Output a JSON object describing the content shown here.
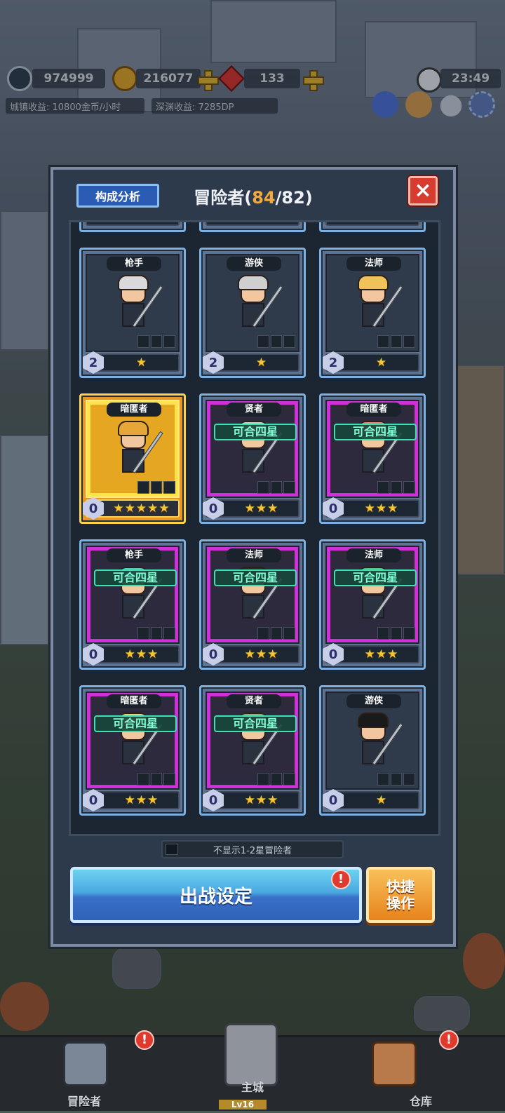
{
  "hud": {
    "currency1": "974999",
    "gold": "216077",
    "gems": "133",
    "time": "23:49",
    "town_income": "城镇收益: 10800金币/小时",
    "abyss_income": "深渊收益: 7285DP"
  },
  "panel": {
    "analysis_label": "构成分析",
    "title_prefix": "冒险者(",
    "count": "84",
    "title_suffix": "/82)",
    "close_symbol": "×",
    "toggle_label": "不显示1-2星冒险者",
    "deploy_label": "出战设定",
    "quick_label_line1": "快捷",
    "quick_label_line2": "操作",
    "alert_symbol": "!"
  },
  "cards": [
    {
      "class": "枪手",
      "level": "2",
      "stars": "★",
      "merge": "",
      "style": "normal",
      "hair": "#d9d9d9"
    },
    {
      "class": "游侠",
      "level": "2",
      "stars": "★",
      "merge": "",
      "style": "normal",
      "hair": "#cfcfcf"
    },
    {
      "class": "法师",
      "level": "2",
      "stars": "★",
      "merge": "",
      "style": "normal",
      "hair": "#f0c35a"
    },
    {
      "class": "暗匿者",
      "level": "0",
      "stars": "★★★★★",
      "merge": "",
      "style": "gold",
      "hair": "#e7a63a"
    },
    {
      "class": "贤者",
      "level": "0",
      "stars": "★★★",
      "merge": "可合四星",
      "style": "purple",
      "hair": "#c9d6cf"
    },
    {
      "class": "暗匿者",
      "level": "0",
      "stars": "★★★",
      "merge": "可合四星",
      "style": "purple",
      "hair": "#e9887a"
    },
    {
      "class": "枪手",
      "level": "0",
      "stars": "★★★",
      "merge": "可合四星",
      "style": "purple",
      "hair": "#5bc6c6"
    },
    {
      "class": "法师",
      "level": "0",
      "stars": "★★★",
      "merge": "可合四星",
      "style": "purple",
      "hair": "#2a2a2a"
    },
    {
      "class": "法师",
      "level": "0",
      "stars": "★★★",
      "merge": "可合四星",
      "style": "purple",
      "hair": "#5fc08a"
    },
    {
      "class": "暗匿者",
      "level": "0",
      "stars": "★★★",
      "merge": "可合四星",
      "style": "purple",
      "hair": "#e8d088"
    },
    {
      "class": "贤者",
      "level": "0",
      "stars": "★★★",
      "merge": "可合四星",
      "style": "purple",
      "hair": "#9aa88a"
    },
    {
      "class": "游侠",
      "level": "0",
      "stars": "★",
      "merge": "",
      "style": "normal",
      "hair": "#1a1a1a"
    }
  ],
  "nav": {
    "adventurers": "冒险者",
    "main_city": "主城",
    "main_city_level": "Lv16",
    "warehouse": "仓库"
  }
}
